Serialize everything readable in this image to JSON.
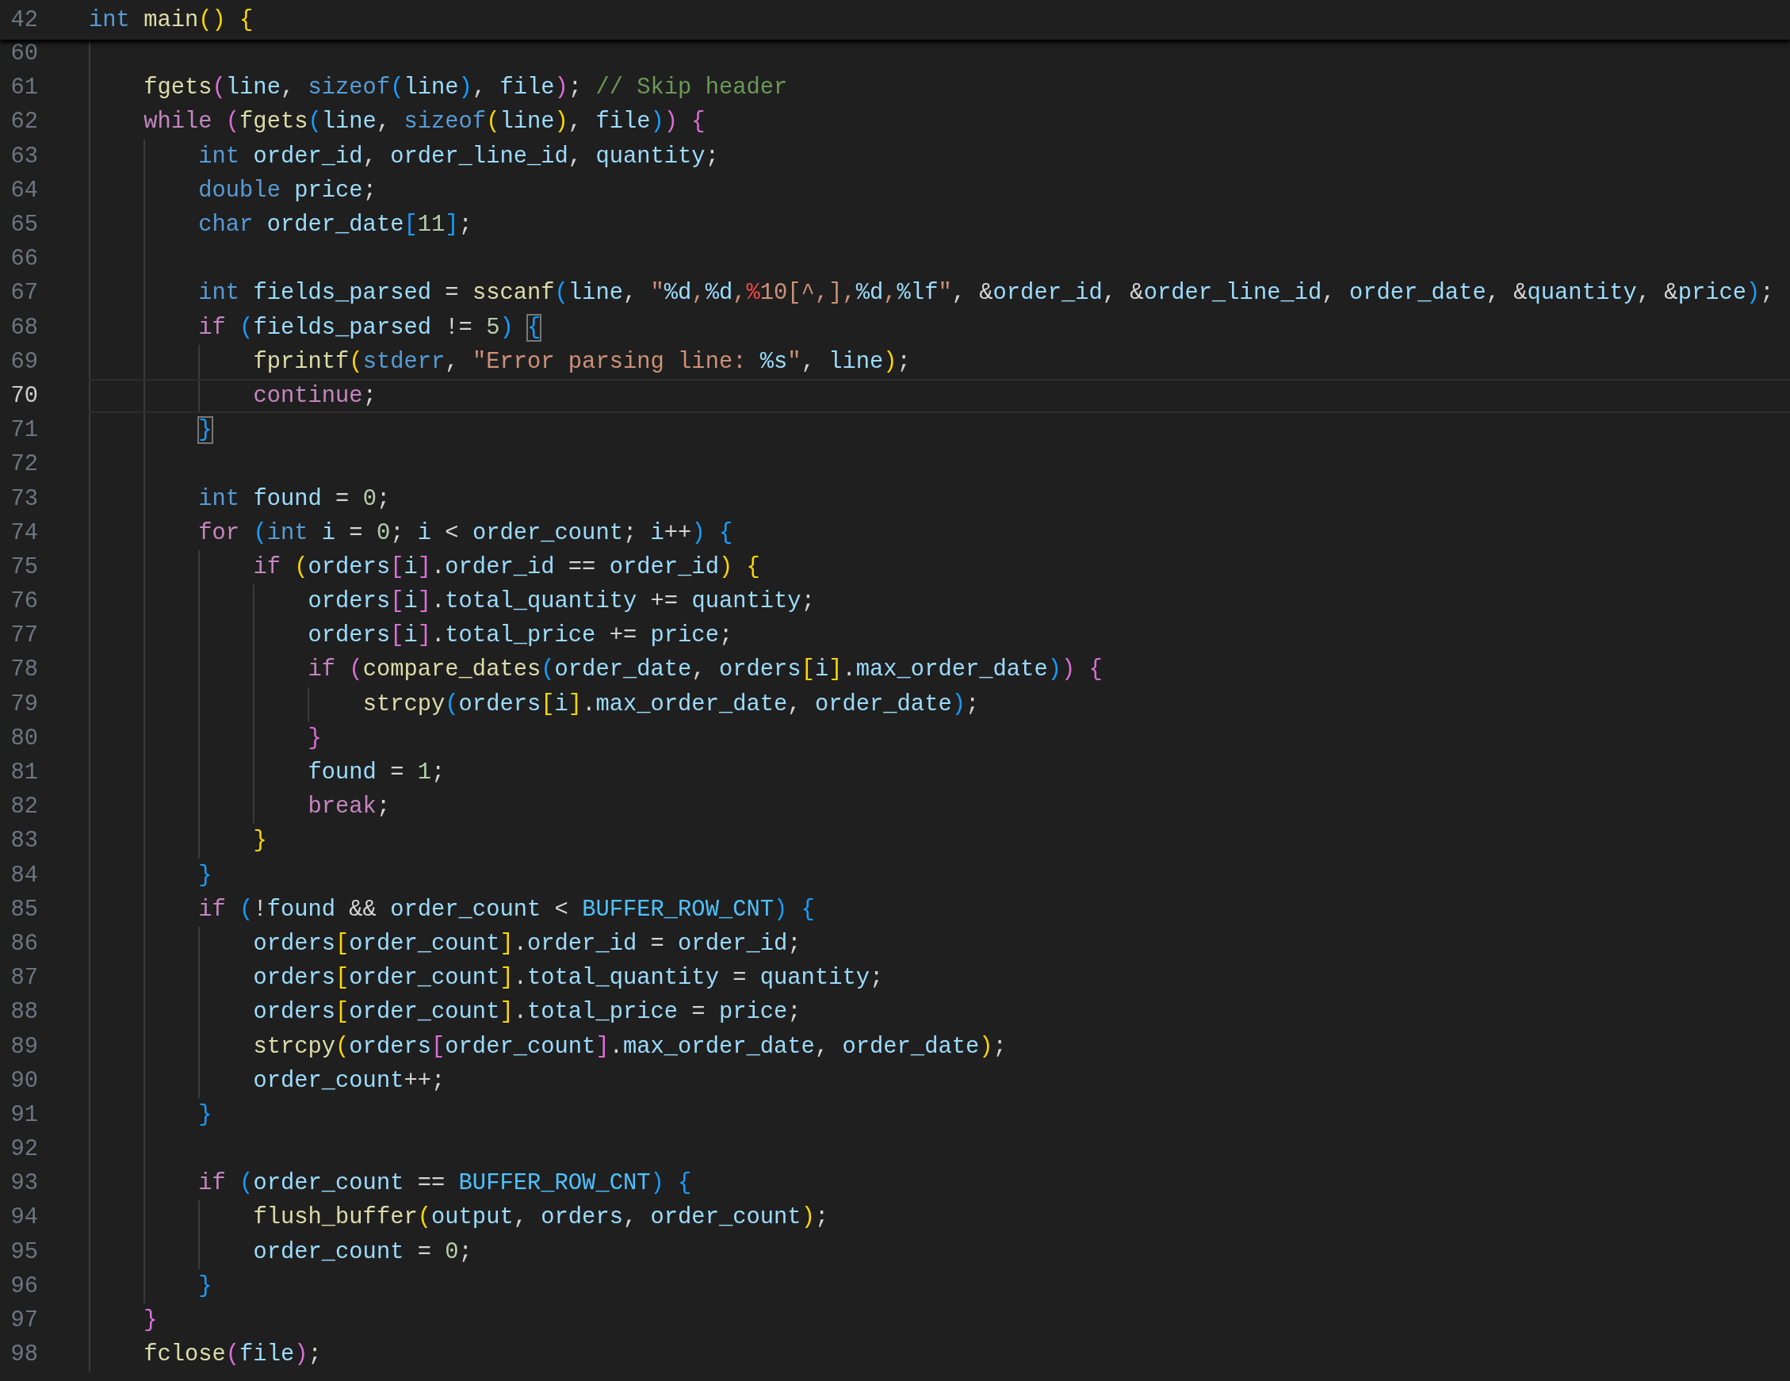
{
  "sticky_line": {
    "number": "42",
    "tokens": [
      {
        "kind": "keyword",
        "text": "int "
      },
      {
        "kind": "function",
        "text": "main"
      },
      {
        "kind": "bracket1",
        "text": "()"
      },
      {
        "kind": "bracket1",
        "text": " {"
      }
    ]
  },
  "lines": [
    {
      "number": "60",
      "current": false
    },
    {
      "number": "61",
      "current": false,
      "tokens": [
        {
          "kind": "function",
          "text": "    fgets"
        },
        {
          "kind": "bracket2",
          "text": "("
        },
        {
          "kind": "variable",
          "text": "line"
        },
        {
          "kind": "plain",
          "text": ", "
        },
        {
          "kind": "keyword",
          "text": "sizeof"
        },
        {
          "kind": "bracket3",
          "text": "("
        },
        {
          "kind": "variable",
          "text": "line"
        },
        {
          "kind": "bracket3",
          "text": ")"
        },
        {
          "kind": "plain",
          "text": ", "
        },
        {
          "kind": "variable",
          "text": "file"
        },
        {
          "kind": "bracket2",
          "text": ")"
        },
        {
          "kind": "plain",
          "text": "; "
        },
        {
          "kind": "comment",
          "text": "// Skip header"
        }
      ]
    },
    {
      "number": "62",
      "current": false,
      "tokens": [
        {
          "kind": "control",
          "text": "    while "
        },
        {
          "kind": "bracket2",
          "text": "("
        },
        {
          "kind": "function",
          "text": "fgets"
        },
        {
          "kind": "bracket3",
          "text": "("
        },
        {
          "kind": "variable",
          "text": "line"
        },
        {
          "kind": "plain",
          "text": ", "
        },
        {
          "kind": "keyword",
          "text": "sizeof"
        },
        {
          "kind": "bracket1",
          "text": "("
        },
        {
          "kind": "variable",
          "text": "line"
        },
        {
          "kind": "bracket1",
          "text": ")"
        },
        {
          "kind": "plain",
          "text": ", "
        },
        {
          "kind": "variable",
          "text": "file"
        },
        {
          "kind": "bracket3",
          "text": ")"
        },
        {
          "kind": "bracket2",
          "text": ")"
        },
        {
          "kind": "bracket2",
          "text": " {"
        }
      ]
    },
    {
      "number": "63",
      "current": false,
      "tokens": [
        {
          "kind": "keyword",
          "text": "        int "
        },
        {
          "kind": "variable",
          "text": "order_id"
        },
        {
          "kind": "plain",
          "text": ", "
        },
        {
          "kind": "variable",
          "text": "order_line_id"
        },
        {
          "kind": "plain",
          "text": ", "
        },
        {
          "kind": "variable",
          "text": "quantity"
        },
        {
          "kind": "plain",
          "text": ";"
        }
      ]
    },
    {
      "number": "64",
      "current": false,
      "tokens": [
        {
          "kind": "keyword",
          "text": "        double "
        },
        {
          "kind": "variable",
          "text": "price"
        },
        {
          "kind": "plain",
          "text": ";"
        }
      ]
    },
    {
      "number": "65",
      "current": false,
      "tokens": [
        {
          "kind": "keyword",
          "text": "        char "
        },
        {
          "kind": "variable",
          "text": "order_date"
        },
        {
          "kind": "bracket3",
          "text": "["
        },
        {
          "kind": "number",
          "text": "11"
        },
        {
          "kind": "bracket3",
          "text": "]"
        },
        {
          "kind": "plain",
          "text": ";"
        }
      ]
    },
    {
      "number": "66",
      "current": false
    },
    {
      "number": "67",
      "current": false,
      "tokens": [
        {
          "kind": "keyword",
          "text": "        int "
        },
        {
          "kind": "variable",
          "text": "fields_parsed"
        },
        {
          "kind": "plain",
          "text": " = "
        },
        {
          "kind": "function",
          "text": "sscanf"
        },
        {
          "kind": "bracket3",
          "text": "("
        },
        {
          "kind": "variable",
          "text": "line"
        },
        {
          "kind": "plain",
          "text": ", "
        },
        {
          "kind": "string",
          "text": "\""
        },
        {
          "kind": "format",
          "text": "%d"
        },
        {
          "kind": "string",
          "text": ","
        },
        {
          "kind": "format",
          "text": "%d"
        },
        {
          "kind": "string",
          "text": ","
        },
        {
          "kind": "invalid",
          "text": "%"
        },
        {
          "kind": "string",
          "text": "10[^,],"
        },
        {
          "kind": "format",
          "text": "%d"
        },
        {
          "kind": "string",
          "text": ","
        },
        {
          "kind": "format",
          "text": "%lf"
        },
        {
          "kind": "string",
          "text": "\""
        },
        {
          "kind": "plain",
          "text": ", &"
        },
        {
          "kind": "variable",
          "text": "order_id"
        },
        {
          "kind": "plain",
          "text": ", &"
        },
        {
          "kind": "variable",
          "text": "order_line_id"
        },
        {
          "kind": "plain",
          "text": ", "
        },
        {
          "kind": "variable",
          "text": "order_date"
        },
        {
          "kind": "plain",
          "text": ", &"
        },
        {
          "kind": "variable",
          "text": "quantity"
        },
        {
          "kind": "plain",
          "text": ", &"
        },
        {
          "kind": "variable",
          "text": "price"
        },
        {
          "kind": "bracket3",
          "text": ")"
        },
        {
          "kind": "plain",
          "text": ";"
        }
      ]
    },
    {
      "number": "68",
      "current": false,
      "tokens": [
        {
          "kind": "control",
          "text": "        if "
        },
        {
          "kind": "bracket3",
          "text": "("
        },
        {
          "kind": "variable",
          "text": "fields_parsed"
        },
        {
          "kind": "plain",
          "text": " != "
        },
        {
          "kind": "number",
          "text": "5"
        },
        {
          "kind": "bracket3",
          "text": ") "
        },
        {
          "kind": "bracket3",
          "text": "{",
          "matched": true
        }
      ]
    },
    {
      "number": "69",
      "current": false,
      "tokens": [
        {
          "kind": "function",
          "text": "            fprintf"
        },
        {
          "kind": "bracket1",
          "text": "("
        },
        {
          "kind": "keyword",
          "text": "stderr"
        },
        {
          "kind": "plain",
          "text": ", "
        },
        {
          "kind": "string",
          "text": "\"Error parsing line: "
        },
        {
          "kind": "format",
          "text": "%s"
        },
        {
          "kind": "string",
          "text": "\""
        },
        {
          "kind": "plain",
          "text": ", "
        },
        {
          "kind": "variable",
          "text": "line"
        },
        {
          "kind": "bracket1",
          "text": ")"
        },
        {
          "kind": "plain",
          "text": ";"
        }
      ]
    },
    {
      "number": "70",
      "current": true,
      "tokens": [
        {
          "kind": "control",
          "text": "            continue"
        },
        {
          "kind": "plain",
          "text": ";"
        }
      ]
    },
    {
      "number": "71",
      "current": false,
      "tokens": [
        {
          "kind": "bracket3",
          "text": "        }",
          "matched": true
        }
      ]
    },
    {
      "number": "72",
      "current": false
    },
    {
      "number": "73",
      "current": false,
      "tokens": [
        {
          "kind": "keyword",
          "text": "        int "
        },
        {
          "kind": "variable",
          "text": "found"
        },
        {
          "kind": "plain",
          "text": " = "
        },
        {
          "kind": "number",
          "text": "0"
        },
        {
          "kind": "plain",
          "text": ";"
        }
      ]
    },
    {
      "number": "74",
      "current": false,
      "tokens": [
        {
          "kind": "control",
          "text": "        for "
        },
        {
          "kind": "bracket3",
          "text": "("
        },
        {
          "kind": "keyword",
          "text": "int "
        },
        {
          "kind": "variable",
          "text": "i"
        },
        {
          "kind": "plain",
          "text": " = "
        },
        {
          "kind": "number",
          "text": "0"
        },
        {
          "kind": "plain",
          "text": "; "
        },
        {
          "kind": "variable",
          "text": "i"
        },
        {
          "kind": "plain",
          "text": " < "
        },
        {
          "kind": "variable",
          "text": "order_count"
        },
        {
          "kind": "plain",
          "text": "; "
        },
        {
          "kind": "variable",
          "text": "i"
        },
        {
          "kind": "plain",
          "text": "++"
        },
        {
          "kind": "bracket3",
          "text": ")"
        },
        {
          "kind": "bracket3",
          "text": " {"
        }
      ]
    },
    {
      "number": "75",
      "current": false,
      "tokens": [
        {
          "kind": "control",
          "text": "            if "
        },
        {
          "kind": "bracket1",
          "text": "("
        },
        {
          "kind": "variable",
          "text": "orders"
        },
        {
          "kind": "bracket2",
          "text": "["
        },
        {
          "kind": "variable",
          "text": "i"
        },
        {
          "kind": "bracket2",
          "text": "]"
        },
        {
          "kind": "plain",
          "text": "."
        },
        {
          "kind": "variable",
          "text": "order_id"
        },
        {
          "kind": "plain",
          "text": " == "
        },
        {
          "kind": "variable",
          "text": "order_id"
        },
        {
          "kind": "bracket1",
          "text": ")"
        },
        {
          "kind": "bracket1",
          "text": " {"
        }
      ]
    },
    {
      "number": "76",
      "current": false,
      "tokens": [
        {
          "kind": "variable",
          "text": "                orders"
        },
        {
          "kind": "bracket2",
          "text": "["
        },
        {
          "kind": "variable",
          "text": "i"
        },
        {
          "kind": "bracket2",
          "text": "]"
        },
        {
          "kind": "plain",
          "text": "."
        },
        {
          "kind": "variable",
          "text": "total_quantity"
        },
        {
          "kind": "plain",
          "text": " += "
        },
        {
          "kind": "variable",
          "text": "quantity"
        },
        {
          "kind": "plain",
          "text": ";"
        }
      ]
    },
    {
      "number": "77",
      "current": false,
      "tokens": [
        {
          "kind": "variable",
          "text": "                orders"
        },
        {
          "kind": "bracket2",
          "text": "["
        },
        {
          "kind": "variable",
          "text": "i"
        },
        {
          "kind": "bracket2",
          "text": "]"
        },
        {
          "kind": "plain",
          "text": "."
        },
        {
          "kind": "variable",
          "text": "total_price"
        },
        {
          "kind": "plain",
          "text": " += "
        },
        {
          "kind": "variable",
          "text": "price"
        },
        {
          "kind": "plain",
          "text": ";"
        }
      ]
    },
    {
      "number": "78",
      "current": false,
      "tokens": [
        {
          "kind": "control",
          "text": "                if "
        },
        {
          "kind": "bracket2",
          "text": "("
        },
        {
          "kind": "function",
          "text": "compare_dates"
        },
        {
          "kind": "bracket3",
          "text": "("
        },
        {
          "kind": "variable",
          "text": "order_date"
        },
        {
          "kind": "plain",
          "text": ", "
        },
        {
          "kind": "variable",
          "text": "orders"
        },
        {
          "kind": "bracket1",
          "text": "["
        },
        {
          "kind": "variable",
          "text": "i"
        },
        {
          "kind": "bracket1",
          "text": "]"
        },
        {
          "kind": "plain",
          "text": "."
        },
        {
          "kind": "variable",
          "text": "max_order_date"
        },
        {
          "kind": "bracket3",
          "text": ")"
        },
        {
          "kind": "bracket2",
          "text": ")"
        },
        {
          "kind": "bracket2",
          "text": " {"
        }
      ]
    },
    {
      "number": "79",
      "current": false,
      "tokens": [
        {
          "kind": "function",
          "text": "                    strcpy"
        },
        {
          "kind": "bracket3",
          "text": "("
        },
        {
          "kind": "variable",
          "text": "orders"
        },
        {
          "kind": "bracket1",
          "text": "["
        },
        {
          "kind": "variable",
          "text": "i"
        },
        {
          "kind": "bracket1",
          "text": "]"
        },
        {
          "kind": "plain",
          "text": "."
        },
        {
          "kind": "variable",
          "text": "max_order_date"
        },
        {
          "kind": "plain",
          "text": ", "
        },
        {
          "kind": "variable",
          "text": "order_date"
        },
        {
          "kind": "bracket3",
          "text": ")"
        },
        {
          "kind": "plain",
          "text": ";"
        }
      ]
    },
    {
      "number": "80",
      "current": false,
      "tokens": [
        {
          "kind": "bracket2",
          "text": "                }"
        }
      ]
    },
    {
      "number": "81",
      "current": false,
      "tokens": [
        {
          "kind": "variable",
          "text": "                found"
        },
        {
          "kind": "plain",
          "text": " = "
        },
        {
          "kind": "number",
          "text": "1"
        },
        {
          "kind": "plain",
          "text": ";"
        }
      ]
    },
    {
      "number": "82",
      "current": false,
      "tokens": [
        {
          "kind": "control",
          "text": "                break"
        },
        {
          "kind": "plain",
          "text": ";"
        }
      ]
    },
    {
      "number": "83",
      "current": false,
      "tokens": [
        {
          "kind": "bracket1",
          "text": "            }"
        }
      ]
    },
    {
      "number": "84",
      "current": false,
      "tokens": [
        {
          "kind": "bracket3",
          "text": "        }"
        }
      ]
    },
    {
      "number": "85",
      "current": false,
      "tokens": [
        {
          "kind": "control",
          "text": "        if "
        },
        {
          "kind": "bracket3",
          "text": "("
        },
        {
          "kind": "plain",
          "text": "!"
        },
        {
          "kind": "variable",
          "text": "found"
        },
        {
          "kind": "plain",
          "text": " && "
        },
        {
          "kind": "variable",
          "text": "order_count"
        },
        {
          "kind": "plain",
          "text": " < "
        },
        {
          "kind": "constant",
          "text": "BUFFER_ROW_CNT"
        },
        {
          "kind": "bracket3",
          "text": ")"
        },
        {
          "kind": "bracket3",
          "text": " {"
        }
      ]
    },
    {
      "number": "86",
      "current": false,
      "tokens": [
        {
          "kind": "variable",
          "text": "            orders"
        },
        {
          "kind": "bracket1",
          "text": "["
        },
        {
          "kind": "variable",
          "text": "order_count"
        },
        {
          "kind": "bracket1",
          "text": "]"
        },
        {
          "kind": "plain",
          "text": "."
        },
        {
          "kind": "variable",
          "text": "order_id"
        },
        {
          "kind": "plain",
          "text": " = "
        },
        {
          "kind": "variable",
          "text": "order_id"
        },
        {
          "kind": "plain",
          "text": ";"
        }
      ]
    },
    {
      "number": "87",
      "current": false,
      "tokens": [
        {
          "kind": "variable",
          "text": "            orders"
        },
        {
          "kind": "bracket1",
          "text": "["
        },
        {
          "kind": "variable",
          "text": "order_count"
        },
        {
          "kind": "bracket1",
          "text": "]"
        },
        {
          "kind": "plain",
          "text": "."
        },
        {
          "kind": "variable",
          "text": "total_quantity"
        },
        {
          "kind": "plain",
          "text": " = "
        },
        {
          "kind": "variable",
          "text": "quantity"
        },
        {
          "kind": "plain",
          "text": ";"
        }
      ]
    },
    {
      "number": "88",
      "current": false,
      "tokens": [
        {
          "kind": "variable",
          "text": "            orders"
        },
        {
          "kind": "bracket1",
          "text": "["
        },
        {
          "kind": "variable",
          "text": "order_count"
        },
        {
          "kind": "bracket1",
          "text": "]"
        },
        {
          "kind": "plain",
          "text": "."
        },
        {
          "kind": "variable",
          "text": "total_price"
        },
        {
          "kind": "plain",
          "text": " = "
        },
        {
          "kind": "variable",
          "text": "price"
        },
        {
          "kind": "plain",
          "text": ";"
        }
      ]
    },
    {
      "number": "89",
      "current": false,
      "tokens": [
        {
          "kind": "function",
          "text": "            strcpy"
        },
        {
          "kind": "bracket1",
          "text": "("
        },
        {
          "kind": "variable",
          "text": "orders"
        },
        {
          "kind": "bracket2",
          "text": "["
        },
        {
          "kind": "variable",
          "text": "order_count"
        },
        {
          "kind": "bracket2",
          "text": "]"
        },
        {
          "kind": "plain",
          "text": "."
        },
        {
          "kind": "variable",
          "text": "max_order_date"
        },
        {
          "kind": "plain",
          "text": ", "
        },
        {
          "kind": "variable",
          "text": "order_date"
        },
        {
          "kind": "bracket1",
          "text": ")"
        },
        {
          "kind": "plain",
          "text": ";"
        }
      ]
    },
    {
      "number": "90",
      "current": false,
      "tokens": [
        {
          "kind": "variable",
          "text": "            order_count"
        },
        {
          "kind": "plain",
          "text": "++;"
        }
      ]
    },
    {
      "number": "91",
      "current": false,
      "tokens": [
        {
          "kind": "bracket3",
          "text": "        }"
        }
      ]
    },
    {
      "number": "92",
      "current": false
    },
    {
      "number": "93",
      "current": false,
      "tokens": [
        {
          "kind": "control",
          "text": "        if "
        },
        {
          "kind": "bracket3",
          "text": "("
        },
        {
          "kind": "variable",
          "text": "order_count"
        },
        {
          "kind": "plain",
          "text": " == "
        },
        {
          "kind": "constant",
          "text": "BUFFER_ROW_CNT"
        },
        {
          "kind": "bracket3",
          "text": ")"
        },
        {
          "kind": "bracket3",
          "text": " {"
        }
      ]
    },
    {
      "number": "94",
      "current": false,
      "tokens": [
        {
          "kind": "function",
          "text": "            flush_buffer"
        },
        {
          "kind": "bracket1",
          "text": "("
        },
        {
          "kind": "variable",
          "text": "output"
        },
        {
          "kind": "plain",
          "text": ", "
        },
        {
          "kind": "variable",
          "text": "orders"
        },
        {
          "kind": "plain",
          "text": ", "
        },
        {
          "kind": "variable",
          "text": "order_count"
        },
        {
          "kind": "bracket1",
          "text": ")"
        },
        {
          "kind": "plain",
          "text": ";"
        }
      ]
    },
    {
      "number": "95",
      "current": false,
      "tokens": [
        {
          "kind": "variable",
          "text": "            order_count"
        },
        {
          "kind": "plain",
          "text": " = "
        },
        {
          "kind": "number",
          "text": "0"
        },
        {
          "kind": "plain",
          "text": ";"
        }
      ]
    },
    {
      "number": "96",
      "current": false,
      "tokens": [
        {
          "kind": "bracket3",
          "text": "        }"
        }
      ]
    },
    {
      "number": "97",
      "current": false,
      "tokens": [
        {
          "kind": "bracket2",
          "text": "    }"
        }
      ]
    },
    {
      "number": "98",
      "current": false,
      "tokens": [
        {
          "kind": "function",
          "text": "    fclose"
        },
        {
          "kind": "bracket2",
          "text": "("
        },
        {
          "kind": "variable",
          "text": "file"
        },
        {
          "kind": "bracket2",
          "text": ")"
        },
        {
          "kind": "plain",
          "text": ";"
        }
      ]
    }
  ]
}
